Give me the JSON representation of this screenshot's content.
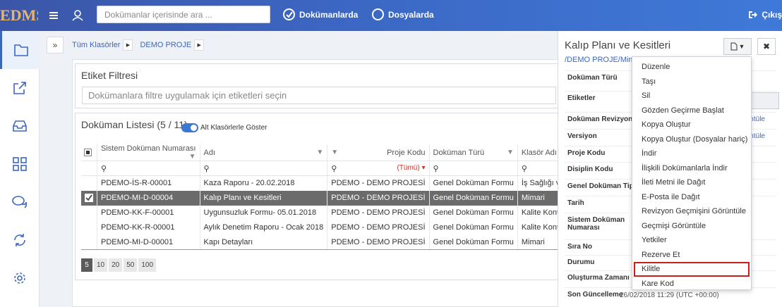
{
  "app": {
    "logo": "EDMS",
    "search_placeholder": "Dokümanlar içerisinde ara ...",
    "radio_docs": "Dokümanlarda",
    "radio_folders": "Dosyalarda",
    "logout": "Çıkış"
  },
  "breadcrumb": {
    "all_folders": "Tüm Klasörler",
    "project": "DEMO PROJE"
  },
  "tag_filter": {
    "title": "Etiket Filtresi",
    "placeholder": "Dokümanlara filtre uygulamak için etiketleri seçin"
  },
  "doc_list": {
    "title": "Doküman Listesi (5 / 11)",
    "toggle_label": "Alt Klasörlerle Göster",
    "columns": [
      "Sistem Doküman Numarası",
      "Adı",
      "Proje Kodu",
      "Doküman Türü",
      "Klasör Adı"
    ],
    "filter_all": "(Tümü)",
    "rows": [
      [
        "PDEMO-İS-R-00001",
        "Kaza Raporu - 20.02.2018",
        "PDEMO - DEMO PROJESİ",
        "Genel Doküman Formu",
        "İş Sağlığı ve Güvenliği"
      ],
      [
        "PDEMO-MI-D-00004",
        "Kalıp Planı ve Kesitleri",
        "PDEMO - DEMO PROJESİ",
        "Genel Doküman Formu",
        "Mimari"
      ],
      [
        "PDEMO-KK-F-00001",
        "Uygunsuzluk Formu- 05.01.2018",
        "PDEMO - DEMO PROJESİ",
        "Genel Doküman Formu",
        "Kalite Kontrol"
      ],
      [
        "PDEMO-KK-R-00001",
        "Aylık Denetim Raporu - Ocak 2018",
        "PDEMO - DEMO PROJESİ",
        "Genel Doküman Formu",
        "Kalite Kontrol"
      ],
      [
        "PDEMO-MI-D-00001",
        "Kapı Detayları",
        "PDEMO - DEMO PROJESİ",
        "Genel Doküman Formu",
        "Mimari"
      ]
    ],
    "page_sizes": [
      "5",
      "10",
      "20",
      "50",
      "100"
    ]
  },
  "detail": {
    "title": "Kalıp Planı ve Kesitleri",
    "path": "/DEMO PROJE/Mimari",
    "labels": [
      "Doküman Türü",
      "Etiketler",
      "Doküman Revizyonu",
      "Versiyon",
      "Proje Kodu",
      "Disiplin Kodu",
      "Genel Doküman Tipi",
      "Tarih",
      "Sistem Doküman Numarası",
      "Sıra No",
      "Durumu",
      "Oluşturma Zamanı",
      "Son Güncelleme"
    ],
    "view_link": "Görüntüle",
    "last_update": "26/02/2018 11:29 (UTC +00:00)"
  },
  "menu": [
    "Düzenle",
    "Taşı",
    "Sil",
    "Gözden Geçirme Başlat",
    "Kopya Oluştur",
    "Kopya Oluştur (Dosyalar hariç)",
    "İndir",
    "İlişkili Dokümanlarla İndir",
    "İleti Metni ile Dağıt",
    "E-Posta ile Dağıt",
    "Revizyon Geçmişini Görüntüle",
    "Geçmişi Görüntüle",
    "Yetkiler",
    "Rezerve Et",
    "Kilitle",
    "Kare Kod"
  ]
}
